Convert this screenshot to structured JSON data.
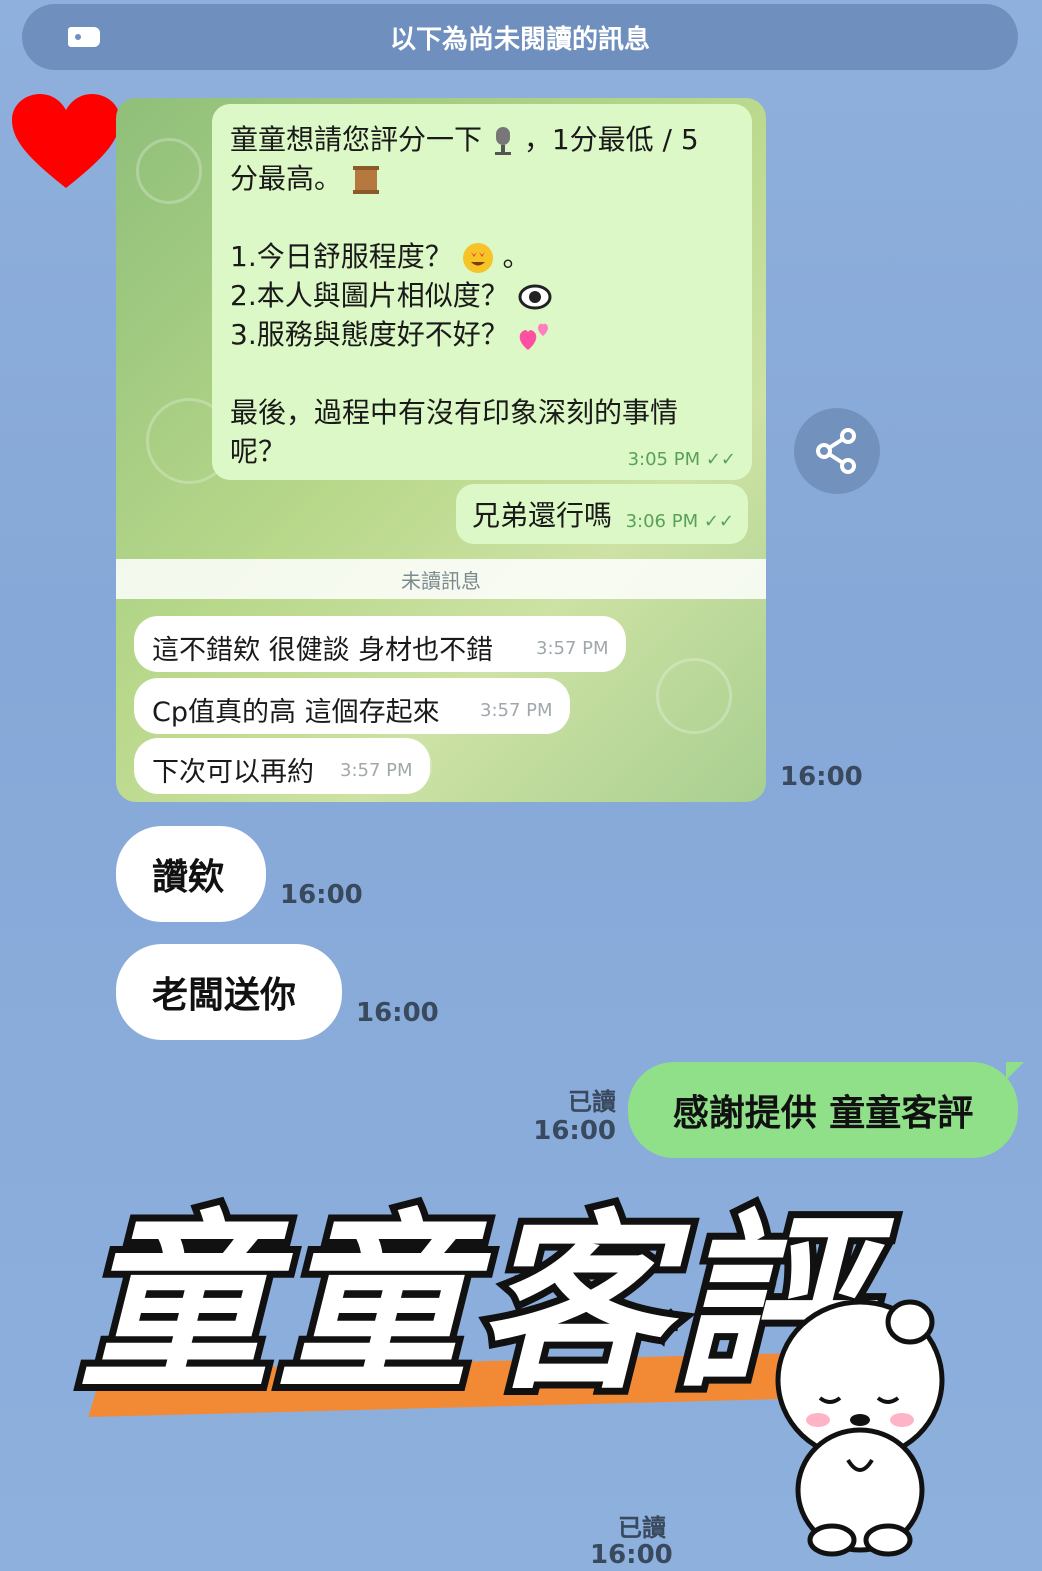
{
  "banner": {
    "text": "以下為尚未閱讀的訊息"
  },
  "telegram": {
    "outgoing": [
      {
        "lines": [
          "童童想請您評分一下",
          "，1分最低 / 5",
          "分最高。",
          "",
          "1.今日舒服程度？",
          "。",
          "2.本人與圖片相似度？",
          "3.服務與態度好不好？",
          "",
          "最後，過程中有沒有印象深刻的事情",
          "呢？"
        ],
        "time": "3:05 PM ✓✓"
      },
      {
        "text": "兄弟還行嗎",
        "time": "3:06 PM ✓✓"
      }
    ],
    "unread_label": "未讀訊息",
    "incoming": [
      {
        "text": "這不錯欸 很健談 身材也不錯",
        "time": "3:57 PM"
      },
      {
        "text": "Cp值真的高 這個存起來",
        "time": "3:57 PM"
      },
      {
        "text": "下次可以再約",
        "time": "3:57 PM"
      }
    ]
  },
  "chat": {
    "image_time": "16:00",
    "incoming": [
      {
        "text": "讚欸",
        "time": "16:00"
      },
      {
        "text": "老闆送你",
        "time": "16:00"
      }
    ],
    "outgoing": {
      "text": "感謝提供 童童客評",
      "read": "已讀",
      "time": "16:00"
    },
    "bottom_read": "已讀",
    "bottom_time": "16:00"
  },
  "overlay": {
    "title": "童童客評",
    "accent": "#f28a35"
  },
  "colors": {
    "line_green": "#8fe089",
    "telegram_green": "#dcf8c6",
    "heart": "#ff0000"
  },
  "icons": [
    "tag-icon",
    "heart-icon",
    "share-icon",
    "microphone-icon",
    "scroll-icon",
    "heart-eyes-icon",
    "eye-icon",
    "two-hearts-icon",
    "double-check-icon",
    "bear-sticker-icon"
  ]
}
